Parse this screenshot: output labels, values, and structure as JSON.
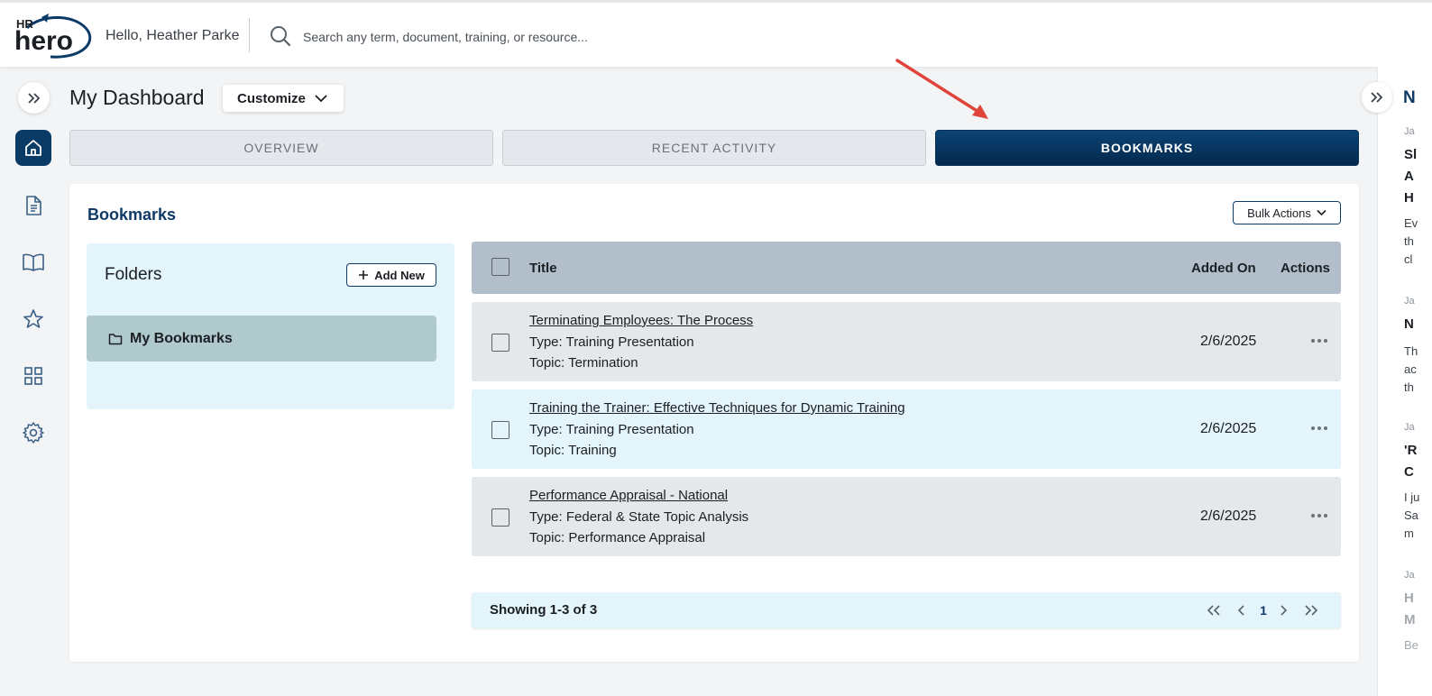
{
  "header": {
    "logo_top": "HR",
    "logo_main": "hero",
    "greeting": "Hello, Heather Parke",
    "search_placeholder": "Search any term, document, training, or resource..."
  },
  "sidebar": {
    "items": [
      {
        "icon": "home-icon",
        "active": true
      },
      {
        "icon": "document-icon",
        "active": false
      },
      {
        "icon": "book-icon",
        "active": false
      },
      {
        "icon": "star-icon",
        "active": false
      },
      {
        "icon": "grid-icon",
        "active": false
      },
      {
        "icon": "gear-icon",
        "active": false
      }
    ]
  },
  "page": {
    "title": "My Dashboard",
    "customize_label": "Customize"
  },
  "tabs": [
    {
      "label": "OVERVIEW",
      "active": false
    },
    {
      "label": "RECENT ACTIVITY",
      "active": false
    },
    {
      "label": "BOOKMARKS",
      "active": true
    }
  ],
  "bookmarks": {
    "title": "Bookmarks",
    "bulk_actions_label": "Bulk Actions",
    "folders": {
      "title": "Folders",
      "add_new_label": "Add New",
      "items": [
        {
          "label": "My Bookmarks",
          "selected": true
        }
      ]
    },
    "table": {
      "headers": {
        "title": "Title",
        "added_on": "Added On",
        "actions": "Actions"
      },
      "rows": [
        {
          "title": "Terminating Employees: The Process",
          "type": "Type: Training Presentation",
          "topic": "Topic: Termination",
          "added_on": "2/6/2025"
        },
        {
          "title": "Training the Trainer: Effective Techniques for Dynamic Training",
          "type": "Type: Training Presentation",
          "topic": "Topic: Training",
          "added_on": "2/6/2025"
        },
        {
          "title": "Performance Appraisal - National",
          "type": "Type: Federal & State Topic Analysis",
          "topic": "Topic: Performance Appraisal",
          "added_on": "2/6/2025"
        }
      ]
    },
    "pagination": {
      "showing": "Showing 1-3 of 3",
      "current_page": "1"
    }
  },
  "right_panel": {
    "title": "N",
    "items": [
      {
        "date": "Ja",
        "heading": [
          "Sl",
          "A",
          "H"
        ],
        "body": [
          "Ev",
          "th",
          "cl"
        ]
      },
      {
        "date": "Ja",
        "heading": [
          "N"
        ],
        "body": [
          "Th",
          "ac",
          "th"
        ]
      },
      {
        "date": "Ja",
        "heading": [
          "'R",
          "C"
        ],
        "body": [
          "I ju",
          "Sa",
          "m"
        ]
      },
      {
        "date": "Ja",
        "heading": [
          "H",
          "M"
        ],
        "body": [
          "Be"
        ]
      }
    ]
  },
  "colors": {
    "brand_navy": "#0a3b66",
    "tab_active": "#04294c",
    "folder_panel": "#e3f4fb",
    "folder_selected": "#afc9cc",
    "table_header": "#b2bfcb",
    "annotation_arrow": "#e0443a"
  }
}
